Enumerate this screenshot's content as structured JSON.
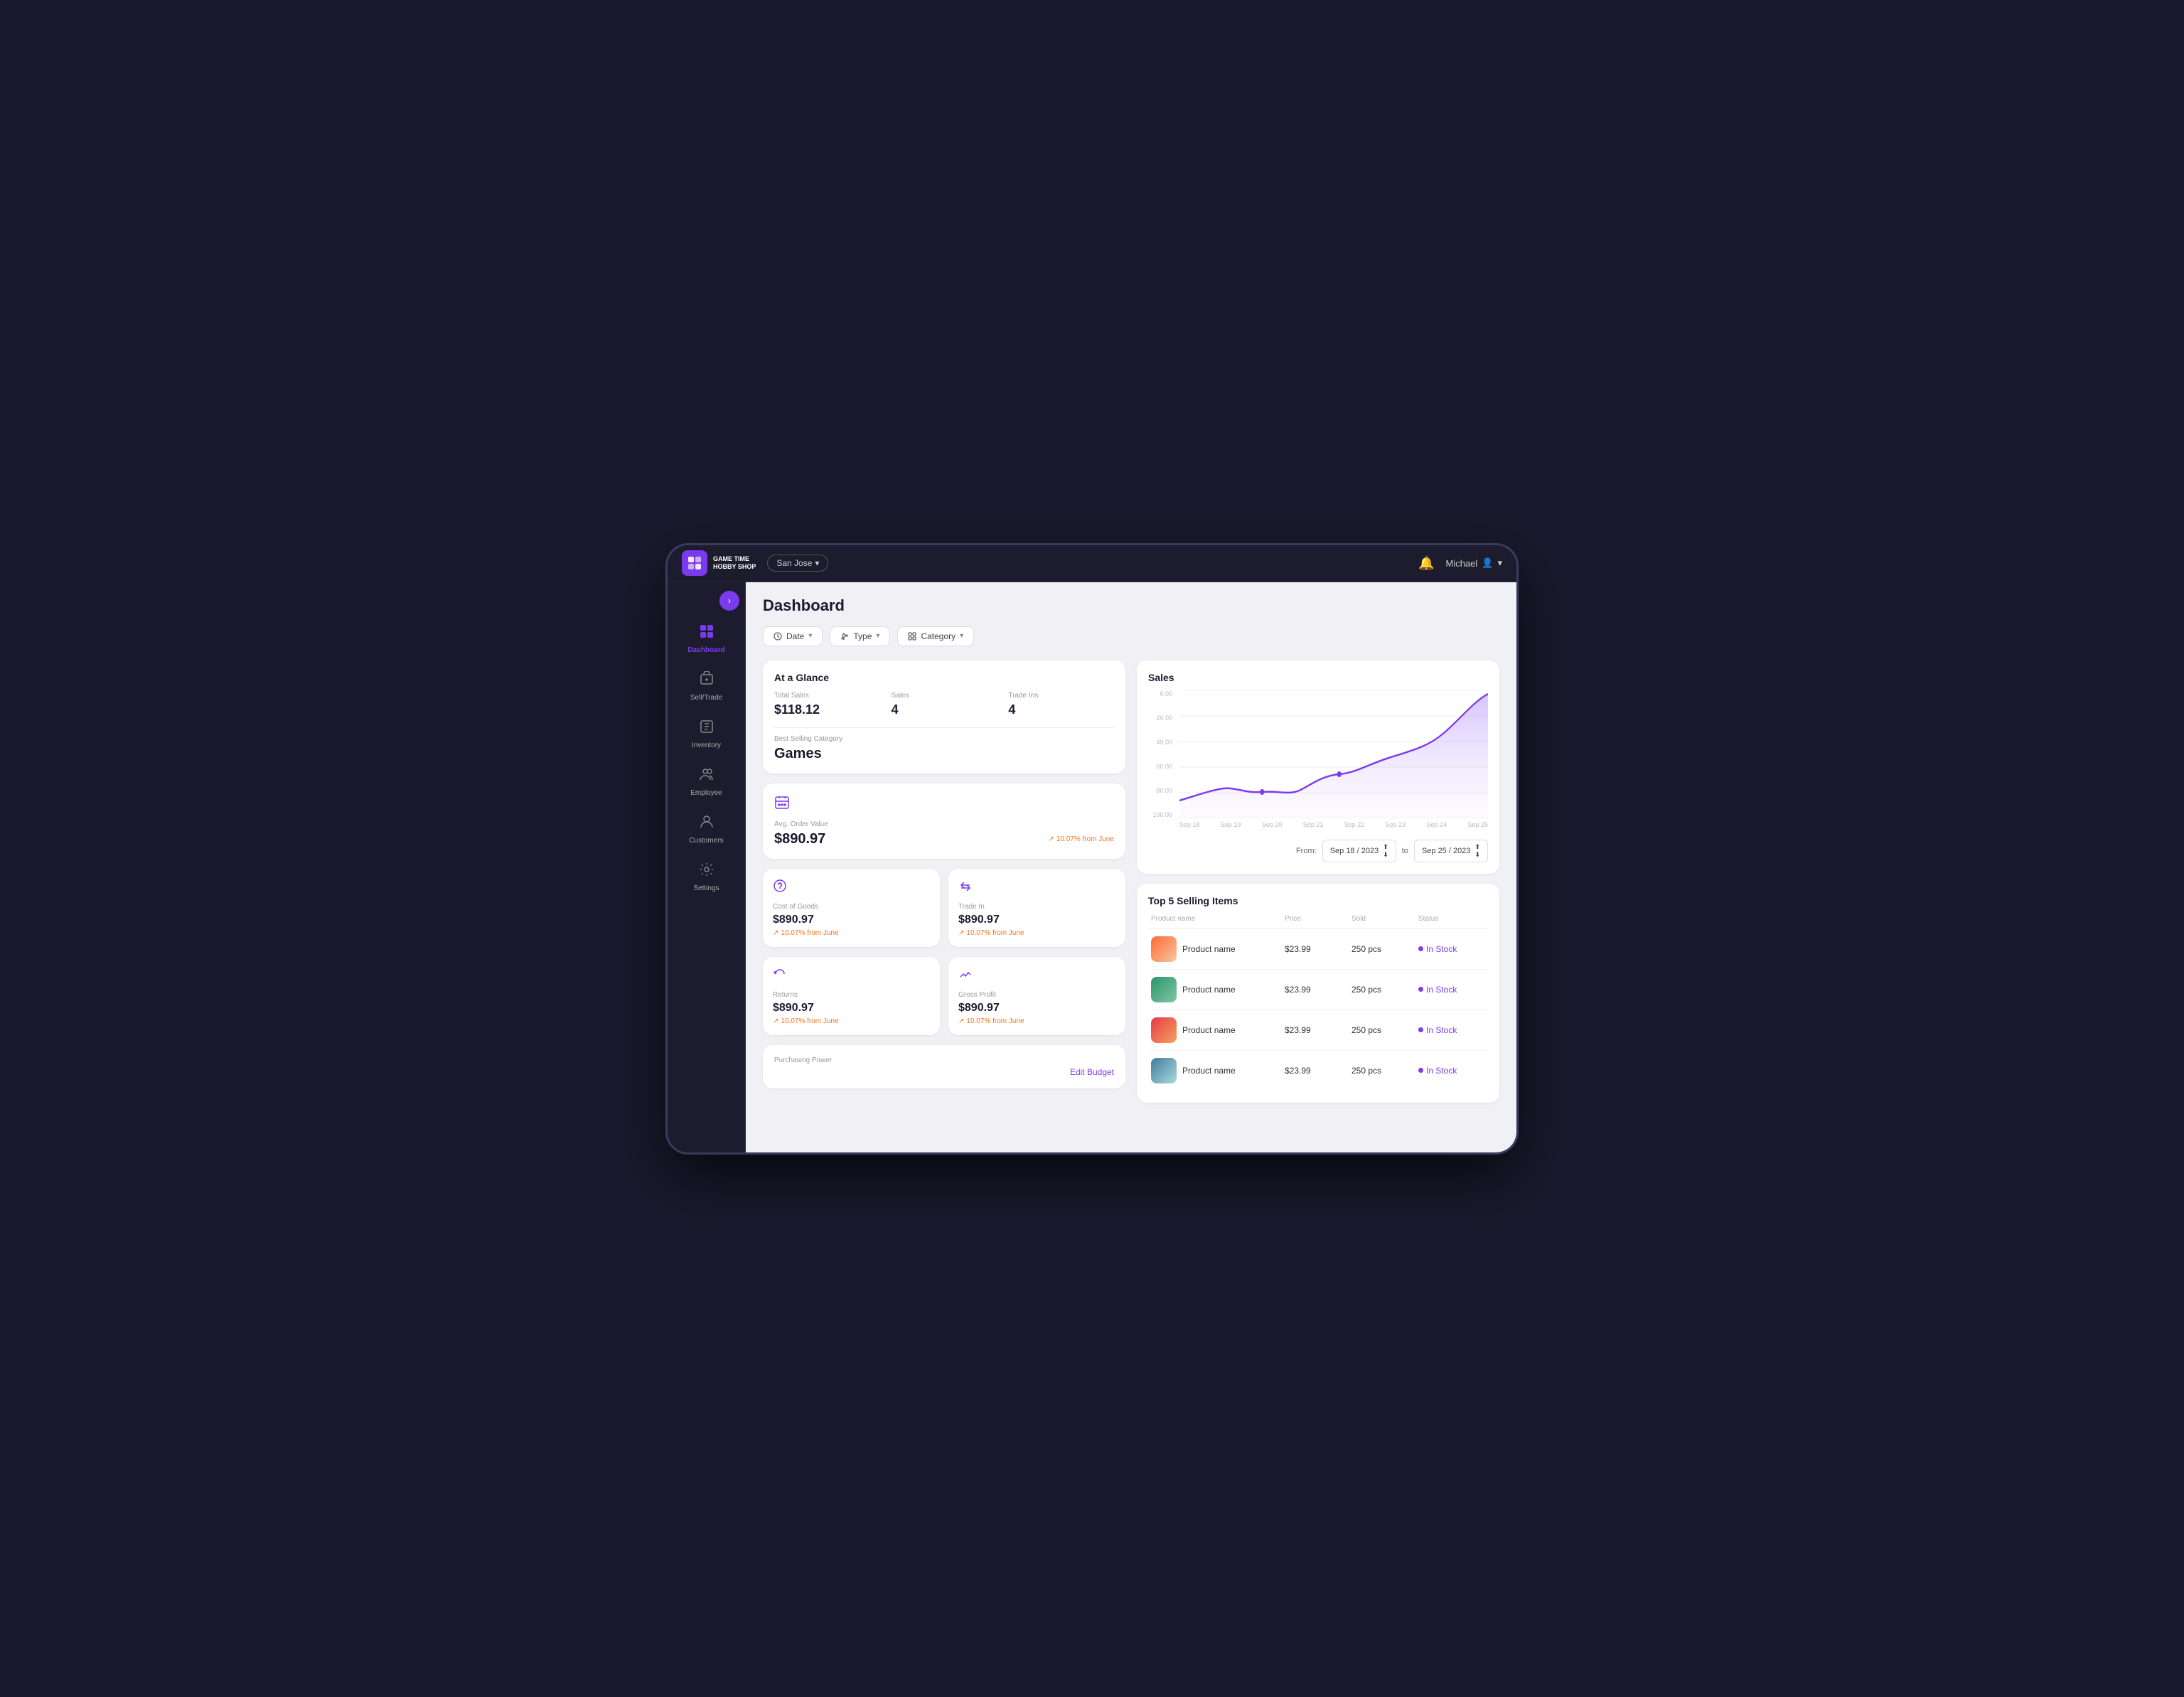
{
  "app": {
    "name": "GAME TIME",
    "subtitle": "HOBBY SHOP",
    "location": "San Jose",
    "user": "Michael",
    "page_title": "Dashboard"
  },
  "filters": {
    "date_label": "Date",
    "type_label": "Type",
    "category_label": "Category"
  },
  "at_a_glance": {
    "title": "At a Glance",
    "total_sales_label": "Total Sales",
    "total_sales_value": "$118.12",
    "sales_label": "Sales",
    "sales_value": "4",
    "trade_ins_label": "Trade Ins",
    "trade_ins_value": "4",
    "best_selling_label": "Best Selling Category",
    "best_selling_value": "Games"
  },
  "avg_order": {
    "label": "Avg. Order Value",
    "value": "$890.97",
    "change": "10.07%",
    "change_note": "from June"
  },
  "cost_of_goods": {
    "label": "Cost of Goods",
    "value": "$890.97",
    "change": "10.07%",
    "change_note": "from June"
  },
  "trade_in": {
    "label": "Trade In",
    "value": "$890.97",
    "change": "10.07%",
    "change_note": "from June"
  },
  "returns": {
    "label": "Returns",
    "value": "$890.97",
    "change": "10.07%",
    "change_note": "from June"
  },
  "gross_profit": {
    "label": "Gross Profit",
    "value": "$890.97",
    "change": "10.07%",
    "change_note": "from June"
  },
  "purchasing_power": {
    "label": "Purchasing Power",
    "edit_label": "Edit Budget"
  },
  "sales_chart": {
    "title": "Sales",
    "y_labels": [
      "100.00",
      "80.00",
      "60.00",
      "40.00",
      "20.00",
      "0.00"
    ],
    "x_labels": [
      "Sep 18",
      "Sep 19",
      "Sep 20",
      "Sep 21",
      "Sep 22",
      "Sep 23",
      "Sep 24",
      "Sep 25"
    ],
    "date_from": "Sep 18 / 2023",
    "date_to": "Sep 25 / 2023",
    "from_label": "From:",
    "to_label": "to"
  },
  "top5": {
    "title": "Top 5 Selling Items",
    "columns": [
      "Product name",
      "Price",
      "Sold",
      "Status"
    ],
    "rows": [
      {
        "name": "Product name",
        "price": "$23.99",
        "sold": "250 pcs",
        "status": "In Stock"
      },
      {
        "name": "Product name",
        "price": "$23.99",
        "sold": "250 pcs",
        "status": "In Stock"
      },
      {
        "name": "Product name",
        "price": "$23.99",
        "sold": "250 pcs",
        "status": "In Stock"
      },
      {
        "name": "Product name",
        "price": "$23.99",
        "sold": "250 pcs",
        "status": "In Stock"
      }
    ]
  },
  "sidebar": {
    "items": [
      {
        "id": "dashboard",
        "label": "Dashboard",
        "icon": "⊞",
        "active": true
      },
      {
        "id": "sell-trade",
        "label": "Sell/Trade",
        "icon": "🏷️",
        "active": false
      },
      {
        "id": "inventory",
        "label": "Inventory",
        "icon": "📋",
        "active": false
      },
      {
        "id": "employee",
        "label": "Employee",
        "icon": "👥",
        "active": false
      },
      {
        "id": "customers",
        "label": "Customers",
        "icon": "🧑‍🤝‍🧑",
        "active": false
      },
      {
        "id": "settings",
        "label": "Settings",
        "icon": "⚙️",
        "active": false
      }
    ]
  }
}
